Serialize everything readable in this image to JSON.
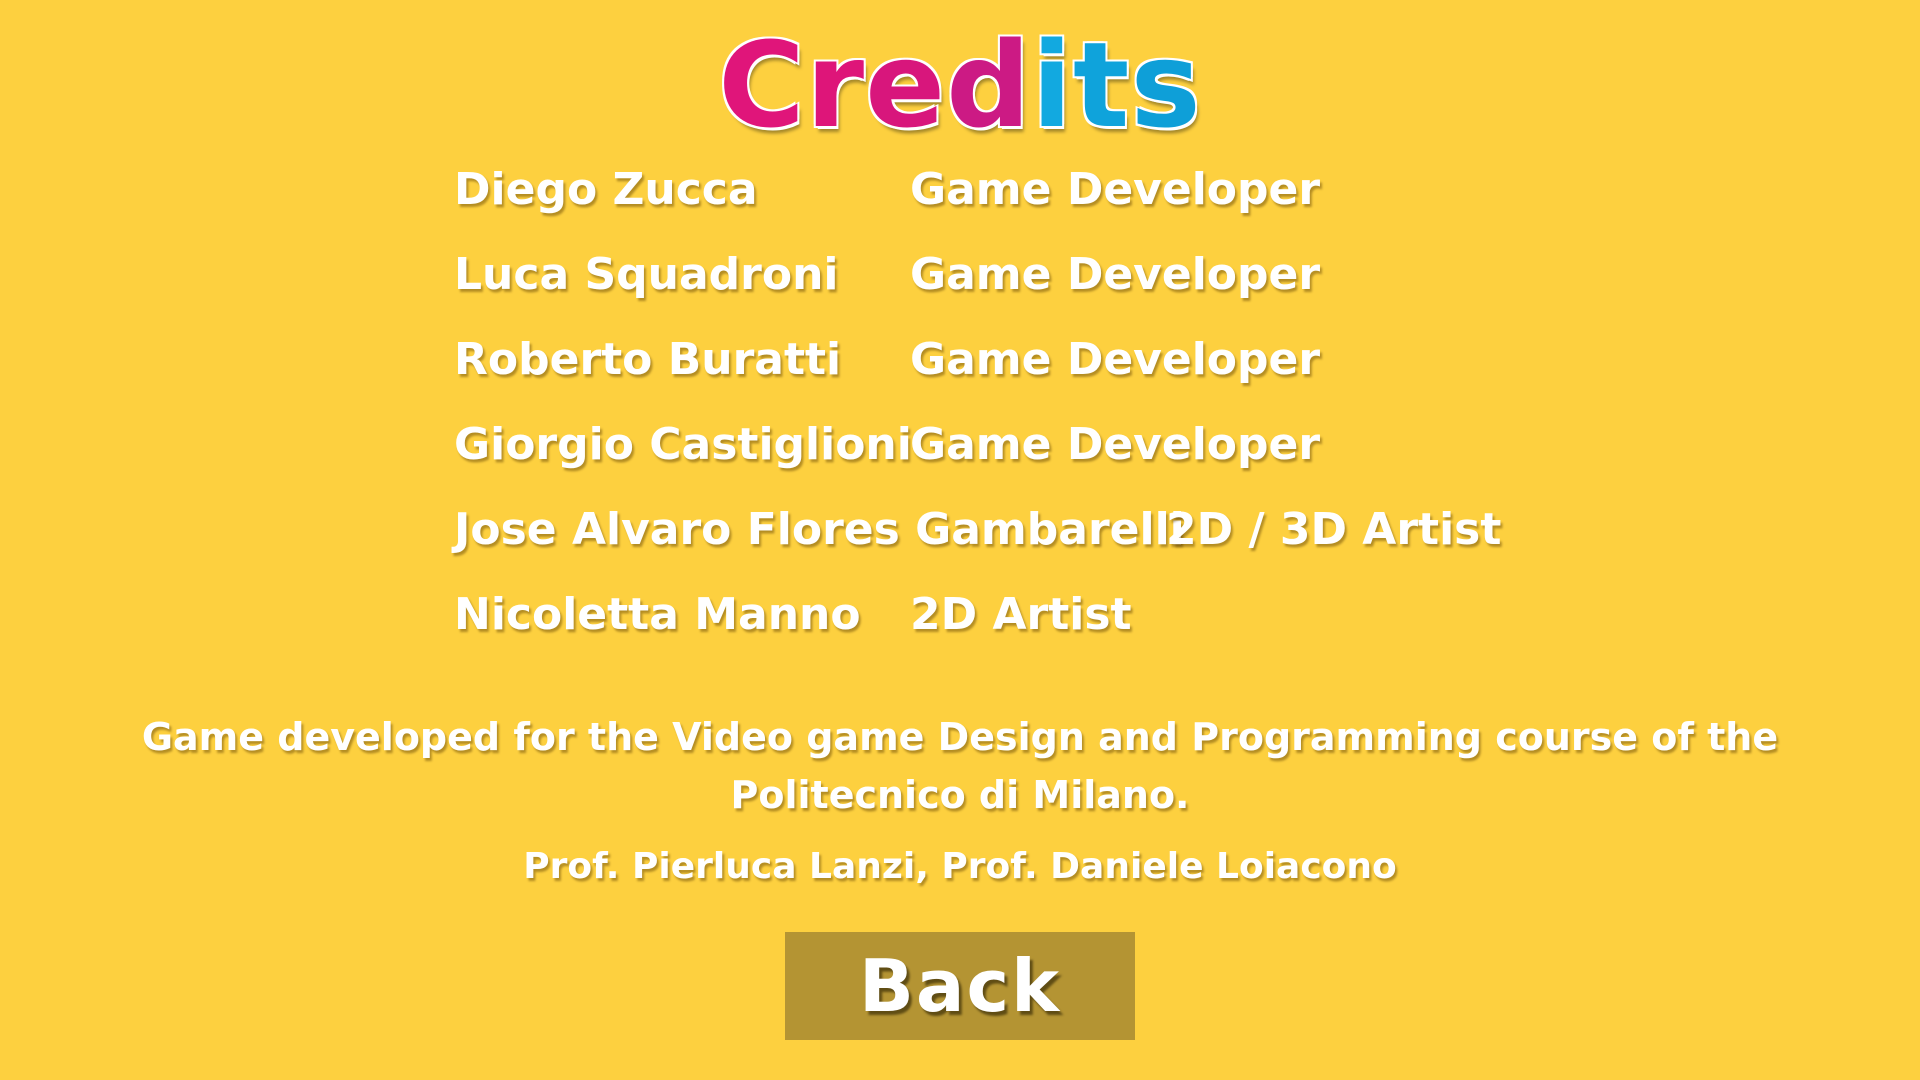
{
  "title": {
    "letters": [
      "C",
      "r",
      "e",
      "d",
      "i",
      "t",
      "s"
    ],
    "letter_colors": [
      "#E0157A",
      "#DE1579",
      "#D8167C",
      "#CC1A84",
      "#12A9E0",
      "#0FA3DB",
      "#0E9FD8"
    ]
  },
  "credits": [
    {
      "name": "Diego Zucca",
      "role": "Game Developer"
    },
    {
      "name": "Luca Squadroni",
      "role": "Game Developer"
    },
    {
      "name": "Roberto Buratti",
      "role": "Game Developer"
    },
    {
      "name": "Giorgio Castiglioni",
      "role": "Game Developer"
    },
    {
      "name": "Jose Alvaro Flores Gambarelli",
      "role": "2D / 3D Artist"
    },
    {
      "name": "Nicoletta Manno",
      "role": "2D Artist"
    }
  ],
  "course_note": "Game developed for the Video game Design and Programming course of the Politecnico di Milano.",
  "professors": "Prof. Pierluca Lanzi, Prof. Daniele Loiacono",
  "back_button": {
    "label": "Back"
  },
  "colors": {
    "background": "#FDD03F",
    "button": "#B49433",
    "text": "#FFFFFF",
    "title_pink": "#E0157A",
    "title_blue": "#12A9E0"
  }
}
